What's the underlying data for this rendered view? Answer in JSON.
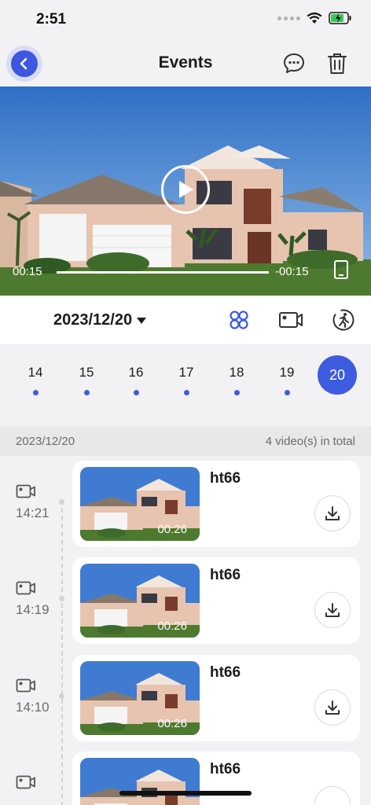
{
  "status": {
    "time": "2:51"
  },
  "nav": {
    "title": "Events",
    "back_icon": "chevron-left-icon",
    "chat_icon": "chat-bubble-icon",
    "trash_icon": "trash-icon"
  },
  "player": {
    "elapsed": "00:15",
    "remaining": "-00:15",
    "progress": 1.0
  },
  "datebar": {
    "date": "2023/12/20",
    "icons": [
      "grid-icon",
      "video-camera-icon",
      "motion-detect-icon"
    ],
    "accent": "#3d5ce0"
  },
  "days": [
    {
      "label": "14",
      "has_events": true
    },
    {
      "label": "15",
      "has_events": true
    },
    {
      "label": "16",
      "has_events": true
    },
    {
      "label": "17",
      "has_events": true
    },
    {
      "label": "18",
      "has_events": true
    },
    {
      "label": "19",
      "has_events": true
    },
    {
      "label": "20",
      "selected": true
    }
  ],
  "summary": {
    "date": "2023/12/20",
    "count_text": "4 video(s) in total"
  },
  "events": [
    {
      "time": "14:21",
      "name": "ht66",
      "duration": "00:26"
    },
    {
      "time": "14:19",
      "name": "ht66",
      "duration": "00:26"
    },
    {
      "time": "14:10",
      "name": "ht66",
      "duration": "00:26"
    },
    {
      "time": "",
      "name": "ht66",
      "duration": ""
    }
  ]
}
